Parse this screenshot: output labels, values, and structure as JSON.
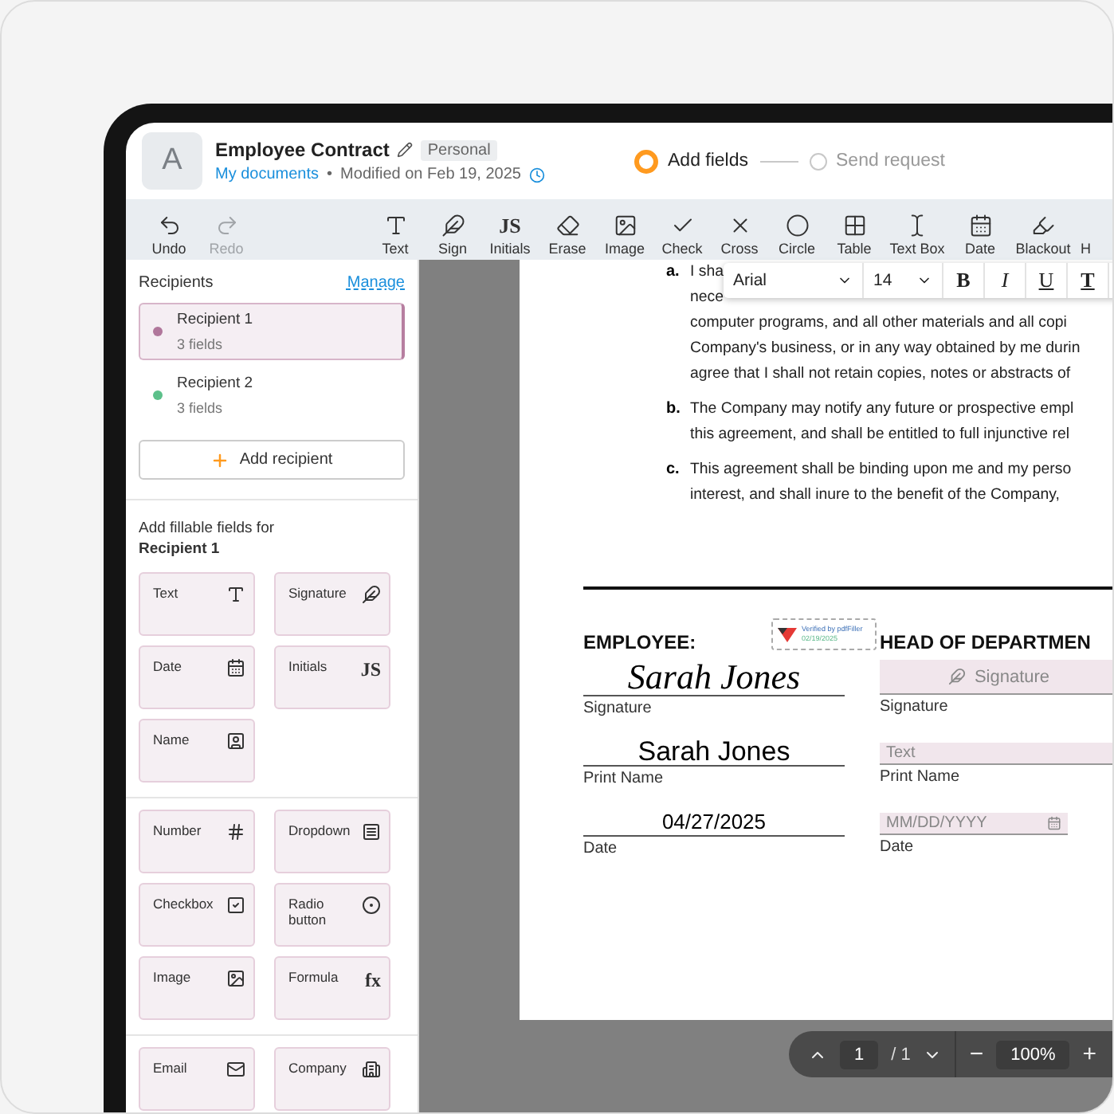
{
  "header": {
    "avatar": "A",
    "title": "Employee Contract",
    "badge": "Personal",
    "breadcrumb": "My documents",
    "separator": "•",
    "modified": "Modified on Feb 19, 2025",
    "steps": [
      {
        "label": "Add fields",
        "selected": true
      },
      {
        "label": "Send request",
        "selected": false
      }
    ]
  },
  "toolbar": {
    "history": [
      {
        "label": "Undo",
        "kind": "undo",
        "disabled": false
      },
      {
        "label": "Redo",
        "kind": "redo",
        "disabled": true
      }
    ],
    "tools": [
      {
        "label": "Text",
        "kind": "text",
        "disabled": false
      },
      {
        "label": "Sign",
        "kind": "sign",
        "disabled": false
      },
      {
        "label": "Initials",
        "kind": "initials",
        "glyph": "JS",
        "disabled": false
      },
      {
        "label": "Erase",
        "kind": "erase",
        "disabled": false
      },
      {
        "label": "Image",
        "kind": "image",
        "disabled": false
      },
      {
        "label": "Check",
        "kind": "check",
        "disabled": false
      },
      {
        "label": "Cross",
        "kind": "cross",
        "disabled": false
      },
      {
        "label": "Circle",
        "kind": "circle",
        "disabled": false
      },
      {
        "label": "Table",
        "kind": "table",
        "disabled": false
      },
      {
        "label": "Text Box",
        "kind": "textbox",
        "disabled": false
      },
      {
        "label": "Date",
        "kind": "date",
        "disabled": false
      },
      {
        "label": "Blackout",
        "kind": "blackout",
        "disabled": false
      },
      {
        "label": "H",
        "kind": "cut",
        "disabled": false
      }
    ]
  },
  "sidebar": {
    "recipients_title": "Recipients",
    "manage": "Manage",
    "recipients": [
      {
        "name": "Recipient 1",
        "fields": "3 fields",
        "color": "#b0769b",
        "selected": true
      },
      {
        "name": "Recipient 2",
        "fields": "3 fields",
        "color": "#5cc08a",
        "selected": false
      }
    ],
    "add_recipient": "Add recipient",
    "fields_heading": "Add fillable fields for",
    "fields_recipient": "Recipient 1",
    "field_groups": [
      [
        {
          "label": "Text",
          "kind": "text"
        },
        {
          "label": "Signature",
          "kind": "signature"
        },
        {
          "label": "Date",
          "kind": "date"
        },
        {
          "label": "Initials",
          "kind": "initials",
          "glyph": "JS"
        },
        {
          "label": "Name",
          "kind": "name"
        }
      ],
      [
        {
          "label": "Number",
          "kind": "number"
        },
        {
          "label": "Dropdown",
          "kind": "dropdown"
        },
        {
          "label": "Checkbox",
          "kind": "checkbox"
        },
        {
          "label": "Radio button",
          "kind": "radio"
        },
        {
          "label": "Image",
          "kind": "image"
        },
        {
          "label": "Formula",
          "kind": "formula",
          "glyph": "fx"
        }
      ],
      [
        {
          "label": "Email",
          "kind": "email"
        },
        {
          "label": "Company",
          "kind": "company"
        }
      ]
    ]
  },
  "format_bar": {
    "font": "Arial",
    "size": "14",
    "buttons": [
      {
        "glyph": "B",
        "kind": "bold"
      },
      {
        "glyph": "I",
        "kind": "italic"
      },
      {
        "glyph": "U",
        "kind": "underline"
      },
      {
        "glyph": "T",
        "kind": "color"
      }
    ]
  },
  "document": {
    "clauses": [
      {
        "marker": "a.",
        "lines": [
          "I sha",
          "nece",
          "computer programs, and all other materials and all copi",
          "Company's business, or in any way obtained by me durin",
          "agree that I shall not retain copies, notes or abstracts of"
        ]
      },
      {
        "marker": "b.",
        "lines": [
          "The Company may notify any future or prospective empl",
          "this agreement, and shall be entitled to full injunctive rel"
        ]
      },
      {
        "marker": "c.",
        "lines": [
          "This agreement shall be binding upon me and my perso",
          "interest, and shall inure to the benefit of the Company,"
        ]
      }
    ],
    "employee": {
      "heading": "EMPLOYEE:",
      "signature": "Sarah Jones",
      "signature_label": "Signature",
      "print_name": "Sarah Jones",
      "print_name_label": "Print Name",
      "date": "04/27/2025",
      "date_label": "Date"
    },
    "stamp": {
      "title": "Verified by pdfFiller",
      "date": "02/19/2025"
    },
    "head": {
      "heading": "HEAD OF DEPARTMEN",
      "signature_field": "Signature",
      "signature_label": "Signature",
      "name_placeholder": "Text",
      "print_name_label": "Print Name",
      "date_placeholder": "MM/DD/YYYY",
      "date_label": "Date"
    }
  },
  "pager": {
    "page": "1",
    "total": "/ 1",
    "zoom": "100%",
    "minus": "−",
    "plus": "+"
  }
}
